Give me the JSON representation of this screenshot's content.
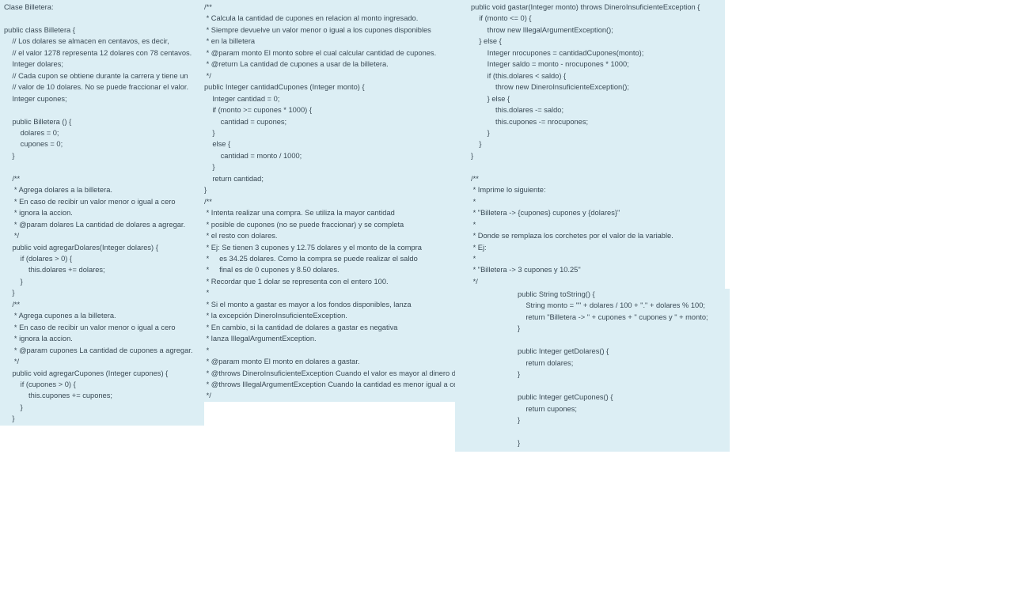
{
  "panel_a": "Clase Billetera:\n\npublic class Billetera {\n    // Los dolares se almacen en centavos, es decir,\n    // el valor 1278 representa 12 dolares con 78 centavos.\n    Integer dolares;\n    // Cada cupon se obtiene durante la carrera y tiene un\n    // valor de 10 dolares. No se puede fraccionar el valor.\n    Integer cupones;\n\n    public Billetera () {\n        dolares = 0;\n        cupones = 0;\n    }\n\n    /**\n     * Agrega dolares a la billetera.\n     * En caso de recibir un valor menor o igual a cero\n     * ignora la accion.\n     * @param dolares La cantidad de dolares a agregar.\n     */\n    public void agregarDolares(Integer dolares) {\n        if (dolares > 0) {\n            this.dolares += dolares;\n        }\n    }\n    /**\n     * Agrega cupones a la billetera.\n     * En caso de recibir un valor menor o igual a cero\n     * ignora la accion.\n     * @param cupones La cantidad de cupones a agregar.\n     */\n    public void agregarCupones (Integer cupones) {\n        if (cupones > 0) {\n            this.cupones += cupones;\n        }\n    }",
  "panel_b": "/**\n * Calcula la cantidad de cupones en relacion al monto ingresado.\n * Siempre devuelve un valor menor o igual a los cupones disponibles\n * en la billetera\n * @param monto El monto sobre el cual calcular cantidad de cupones.\n * @return La cantidad de cupones a usar de la billetera.\n */\npublic Integer cantidadCupones (Integer monto) {\n    Integer cantidad = 0;\n    if (monto >= cupones * 1000) {\n        cantidad = cupones;\n    }\n    else {\n        cantidad = monto / 1000;\n    }\n    return cantidad;\n}\n/**\n * Intenta realizar una compra. Se utiliza la mayor cantidad\n * posible de cupones (no se puede fraccionar) y se completa\n * el resto con dolares.\n * Ej: Se tienen 3 cupones y 12.75 dolares y el monto de la compra\n *     es 34.25 dolares. Como la compra se puede realizar el saldo\n *     final es de 0 cupones y 8.50 dolares.\n * Recordar que 1 dolar se representa con el entero 100.\n *\n * Si el monto a gastar es mayor a los fondos disponibles, lanza\n * la excepción DineroInsuficienteException.\n * En cambio, si la cantidad de dolares a gastar es negativa\n * lanza IllegalArgumentException.\n *\n * @param monto El monto en dolares a gastar.\n * @throws DineroInsuficienteException Cuando el valor es mayor al dinero disponible.\n * @throws IllegalArgumentException Cuando la cantidad es menor igual a cero.\n */",
  "panel_c": "public void gastar(Integer monto) throws DineroInsuficienteException {\n    if (monto <= 0) {\n        throw new IllegalArgumentException();\n    } else {\n        Integer nrocupones = cantidadCupones(monto);\n        Integer saldo = monto - nrocupones * 1000;\n        if (this.dolares < saldo) {\n            throw new DineroInsuficienteException();\n        } else {\n            this.dolares -= saldo;\n            this.cupones -= nrocupones;\n        }\n    }\n}\n\n/**\n * Imprime lo siguiente:\n *\n * \"Billetera -> {cupones} cupones y {dolares}\"\n *\n * Donde se remplaza los corchetes por el valor de la variable.\n * Ej:\n *\n * \"Billetera -> 3 cupones y 10.25\"\n */",
  "panel_d": "public String toString() {\n    String monto = \"\" + dolares / 100 + \".\" + dolares % 100;\n    return \"Billetera -> \" + cupones + \" cupones y \" + monto;\n}\n\npublic Integer getDolares() {\n    return dolares;\n}\n\npublic Integer getCupones() {\n    return cupones;\n}\n\n}"
}
